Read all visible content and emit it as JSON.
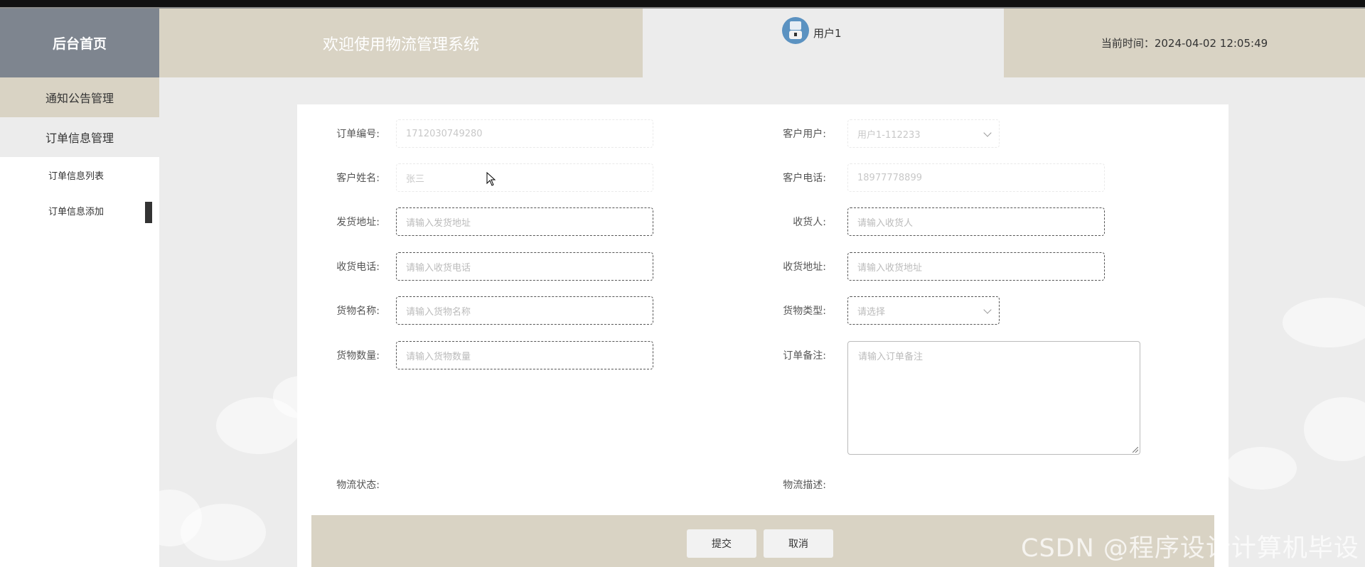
{
  "header": {
    "home_label": "后台首页",
    "welcome_text": "欢迎使用物流管理系统",
    "user_name": "用户1",
    "time_label": "当前时间：",
    "time_value": "2024-04-02 12:05:49"
  },
  "sidebar": {
    "menus": [
      {
        "label": "通知公告管理"
      },
      {
        "label": "订单信息管理"
      }
    ],
    "subitems": [
      {
        "label": "订单信息列表"
      },
      {
        "label": "订单信息添加"
      }
    ]
  },
  "form": {
    "order_no": {
      "label": "订单编号:",
      "value": "1712030749280"
    },
    "customer_user": {
      "label": "客户用户:",
      "value": "用户1-112233"
    },
    "customer_name": {
      "label": "客户姓名:",
      "value": "张三"
    },
    "customer_phone": {
      "label": "客户电话:",
      "value": "18977778899"
    },
    "ship_address": {
      "label": "发货地址:",
      "placeholder": "请输入发货地址"
    },
    "receiver": {
      "label": "收货人:",
      "placeholder": "请输入收货人"
    },
    "receiver_phone": {
      "label": "收货电话:",
      "placeholder": "请输入收货电话"
    },
    "receiver_address": {
      "label": "收货地址:",
      "placeholder": "请输入收货地址"
    },
    "goods_name": {
      "label": "货物名称:",
      "placeholder": "请输入货物名称"
    },
    "goods_type": {
      "label": "货物类型:",
      "placeholder": "请选择"
    },
    "goods_quantity": {
      "label": "货物数量:",
      "placeholder": "请输入货物数量"
    },
    "order_note": {
      "label": "订单备注:",
      "placeholder": "请输入订单备注"
    },
    "logistics_status": {
      "label": "物流状态:"
    },
    "logistics_desc": {
      "label": "物流描述:"
    }
  },
  "actions": {
    "submit": "提交",
    "cancel": "取消"
  },
  "watermark": "CSDN @程序设计计算机毕设",
  "colors": {
    "header_beige": "#d9d3c4",
    "header_gray": "#7e858f",
    "background": "#ececec"
  },
  "icons": {
    "avatar": "user-avatar-robot-icon",
    "select_arrow": "chevron-down-icon",
    "cursor": "mouse-cursor-icon"
  }
}
